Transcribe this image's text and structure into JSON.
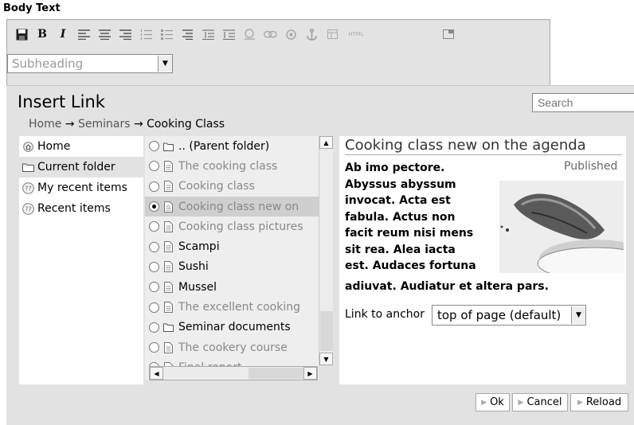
{
  "field_label": "Body Text",
  "toolbar": {
    "buttons": [
      "save-icon",
      "bold-icon",
      "italic-icon",
      "align-left-icon",
      "align-center-icon",
      "align-right-icon",
      "numbered-list-icon",
      "bullet-list-icon",
      "definition-list-icon",
      "indent-icon",
      "outdent-icon",
      "image-icon",
      "link-icon",
      "external-link-icon",
      "anchor-icon",
      "table-icon",
      "html-source-icon",
      "fullscreen-icon"
    ],
    "bold_label": "B",
    "italic_label": "I",
    "html_label": "HTML",
    "style_select": "Subheading"
  },
  "dialog": {
    "title": "Insert Link",
    "search_placeholder": "Search",
    "breadcrumb": [
      "Home",
      "→",
      "Seminars",
      "→",
      "Cooking Class"
    ]
  },
  "sidebar": {
    "items": [
      {
        "label": "Home",
        "icon": "home-icon"
      },
      {
        "label": "Current folder",
        "icon": "folder-icon"
      },
      {
        "label": "My recent items",
        "icon": "recent-icon"
      },
      {
        "label": "Recent items",
        "icon": "recent-icon"
      }
    ]
  },
  "items": [
    {
      "label": ".. (Parent folder)",
      "state": "folder"
    },
    {
      "label": "The cooking class",
      "state": "private"
    },
    {
      "label": "Cooking class",
      "state": "private"
    },
    {
      "label": "Cooking class new on",
      "state": "selected"
    },
    {
      "label": "Cooking class pictures",
      "state": "private"
    },
    {
      "label": "Scampi",
      "state": "published"
    },
    {
      "label": "Sushi",
      "state": "published"
    },
    {
      "label": "Mussel",
      "state": "published"
    },
    {
      "label": "The excellent cooking",
      "state": "private"
    },
    {
      "label": "Seminar documents",
      "state": "folder"
    },
    {
      "label": "The cookery course",
      "state": "private"
    },
    {
      "label": "Final report",
      "state": "private"
    }
  ],
  "preview": {
    "title": "Cooking class new on the agenda",
    "status": "Published",
    "body_lines": [
      "Ab imo pectore.",
      "Abyssus abyssum",
      "invocat. Acta est",
      "fabula. Actus non",
      "facit reum nisi mens",
      "sit rea. Alea iacta",
      "est. Audaces fortuna"
    ],
    "body_tail": "adiuvat. Audiatur et altera pars.",
    "anchor_label": "Link to anchor",
    "anchor_value": "top of page (default)"
  },
  "buttons": {
    "ok": "Ok",
    "cancel": "Cancel",
    "reload": "Reload"
  }
}
